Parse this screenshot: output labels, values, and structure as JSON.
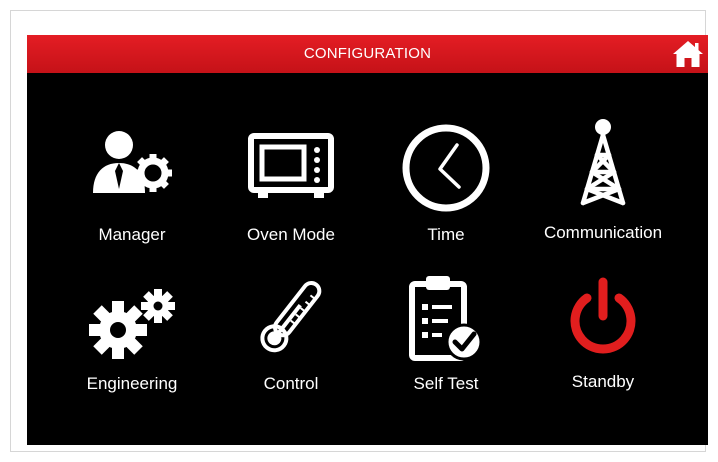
{
  "header": {
    "title": "CONFIGURATION",
    "home_icon": "home-icon"
  },
  "colors": {
    "header_red": "#d9161d",
    "background": "#000000",
    "icon_white": "#ffffff",
    "standby_red": "#e11e1e"
  },
  "menu": [
    {
      "id": "manager",
      "label": "Manager",
      "icon": "manager-icon"
    },
    {
      "id": "oven-mode",
      "label": "Oven Mode",
      "icon": "oven-icon"
    },
    {
      "id": "time",
      "label": "Time",
      "icon": "clock-icon"
    },
    {
      "id": "communication",
      "label": "Communication",
      "icon": "antenna-tower-icon"
    },
    {
      "id": "engineering",
      "label": "Engineering",
      "icon": "gears-icon"
    },
    {
      "id": "control",
      "label": "Control",
      "icon": "thermometer-icon"
    },
    {
      "id": "self-test",
      "label": "Self Test",
      "icon": "clipboard-check-icon"
    },
    {
      "id": "standby",
      "label": "Standby",
      "icon": "power-icon"
    }
  ]
}
